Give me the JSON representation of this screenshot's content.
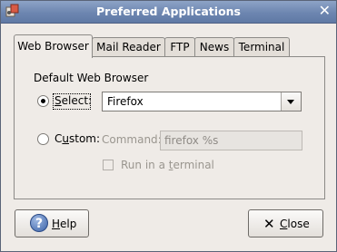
{
  "window": {
    "title": "Preferred Applications"
  },
  "tabs": [
    {
      "label": "Web Browser",
      "active": true
    },
    {
      "label": "Mail Reader",
      "active": false
    },
    {
      "label": "FTP",
      "active": false
    },
    {
      "label": "News",
      "active": false
    },
    {
      "label": "Terminal",
      "active": false
    }
  ],
  "web_browser": {
    "section_label": "Default Web Browser",
    "select_option": {
      "label_pre": "",
      "label_mnemonic": "S",
      "label_post": "elect:",
      "checked": true
    },
    "selected_browser": "Firefox",
    "custom_option": {
      "label_pre": "C",
      "label_mnemonic": "u",
      "label_post": "stom:",
      "checked": false
    },
    "command_label": "Command:",
    "command_value": "firefox %s",
    "run_in_terminal": {
      "label_pre": "Run in a ",
      "label_mnemonic": "t",
      "label_post": "erminal",
      "checked": false
    }
  },
  "buttons": {
    "help": {
      "mnemonic": "H",
      "rest": "elp"
    },
    "close": {
      "mnemonic": "C",
      "rest": "lose"
    }
  },
  "colors": {
    "titlebar": "#6d86b0",
    "window_bg": "#efebe7"
  }
}
